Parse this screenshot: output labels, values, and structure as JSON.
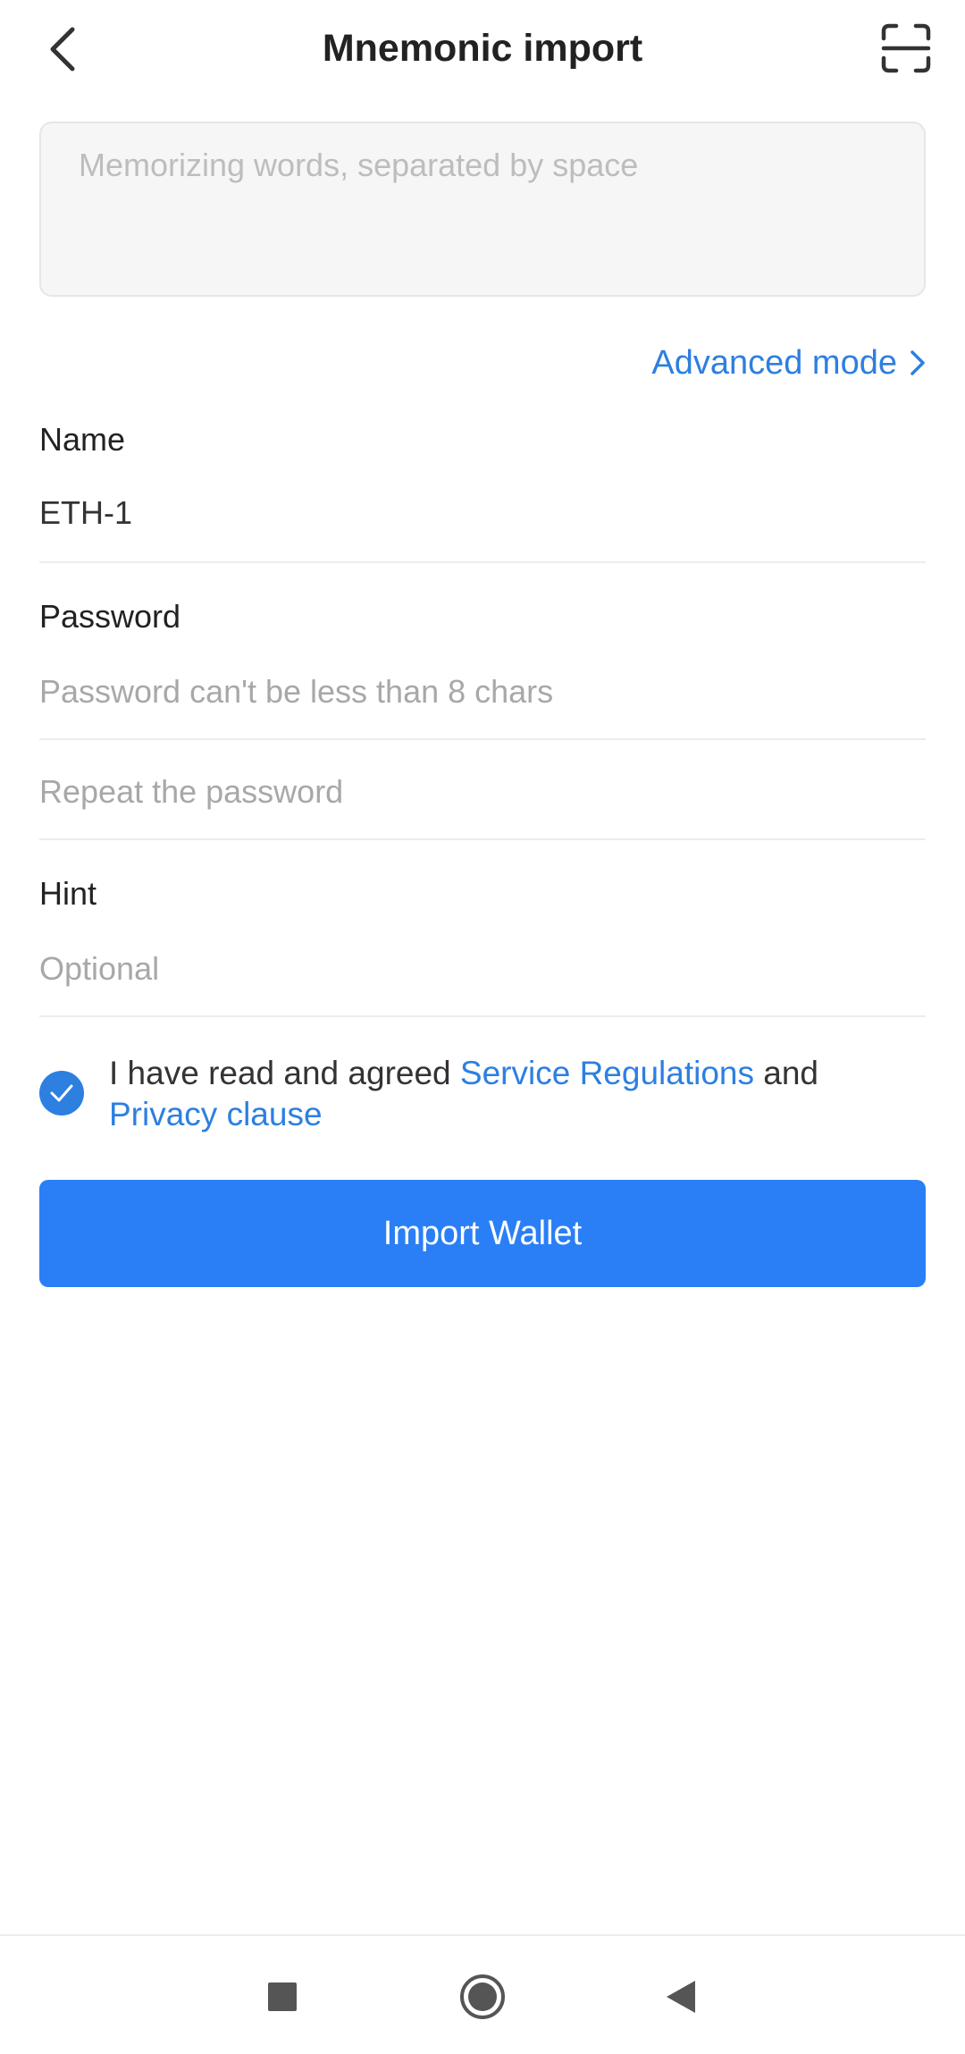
{
  "header": {
    "title": "Mnemonic import",
    "back_icon": "back-arrow-icon",
    "scan_icon": "scan-icon"
  },
  "mnemonic": {
    "placeholder": "Memorizing words, separated by space",
    "value": ""
  },
  "advanced_mode": {
    "label": "Advanced mode",
    "icon": "chevron-right-icon"
  },
  "name": {
    "label": "Name",
    "value": "ETH-1"
  },
  "password": {
    "label": "Password",
    "placeholder": "Password can't be less than 8 chars",
    "repeat_placeholder": "Repeat the password"
  },
  "hint": {
    "label": "Hint",
    "placeholder": "Optional"
  },
  "agreement": {
    "checked": true,
    "text_before": "I have read and agreed ",
    "service_link": "Service Regulations",
    "text_middle": " and ",
    "privacy_link": "Privacy clause"
  },
  "import_button": {
    "label": "Import Wallet"
  },
  "nav": {
    "recents_icon": "square-icon",
    "home_icon": "circle-icon",
    "back_icon": "triangle-back-icon"
  },
  "colors": {
    "accent": "#2a7ff6",
    "link": "#2d7fe0"
  }
}
